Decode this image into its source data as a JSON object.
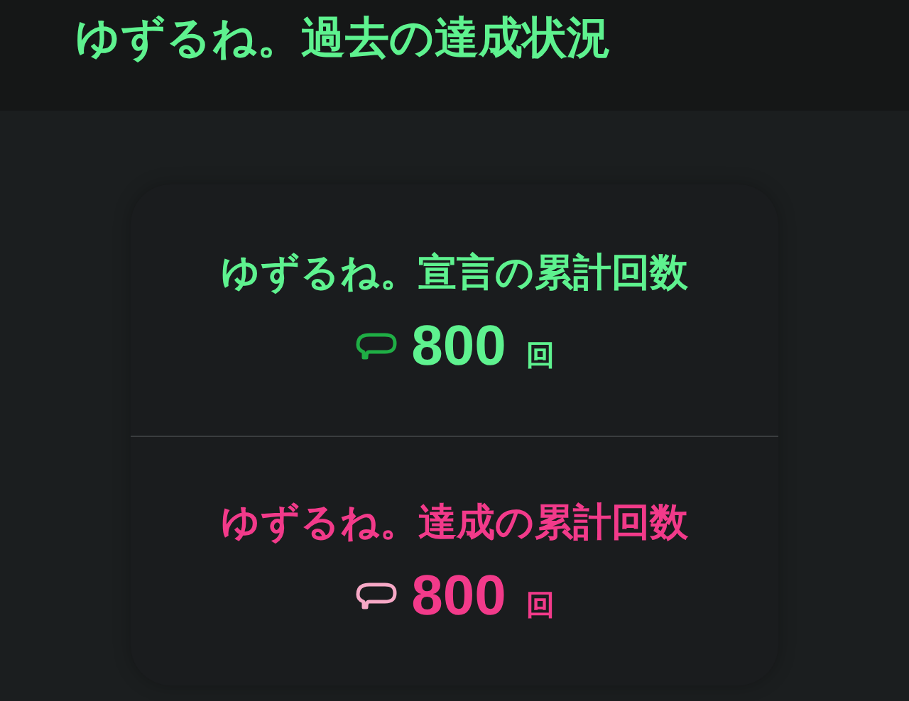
{
  "header": {
    "title": "ゆずるね。過去の達成状況"
  },
  "stats": [
    {
      "kind": "declared",
      "label": "ゆずるね。宣言の累計回数",
      "value": "800",
      "unit": "回",
      "color": "#5ef28f"
    },
    {
      "kind": "achieved",
      "label": "ゆずるね。達成の累計回数",
      "value": "800",
      "unit": "回",
      "color": "#f23a8a"
    }
  ]
}
